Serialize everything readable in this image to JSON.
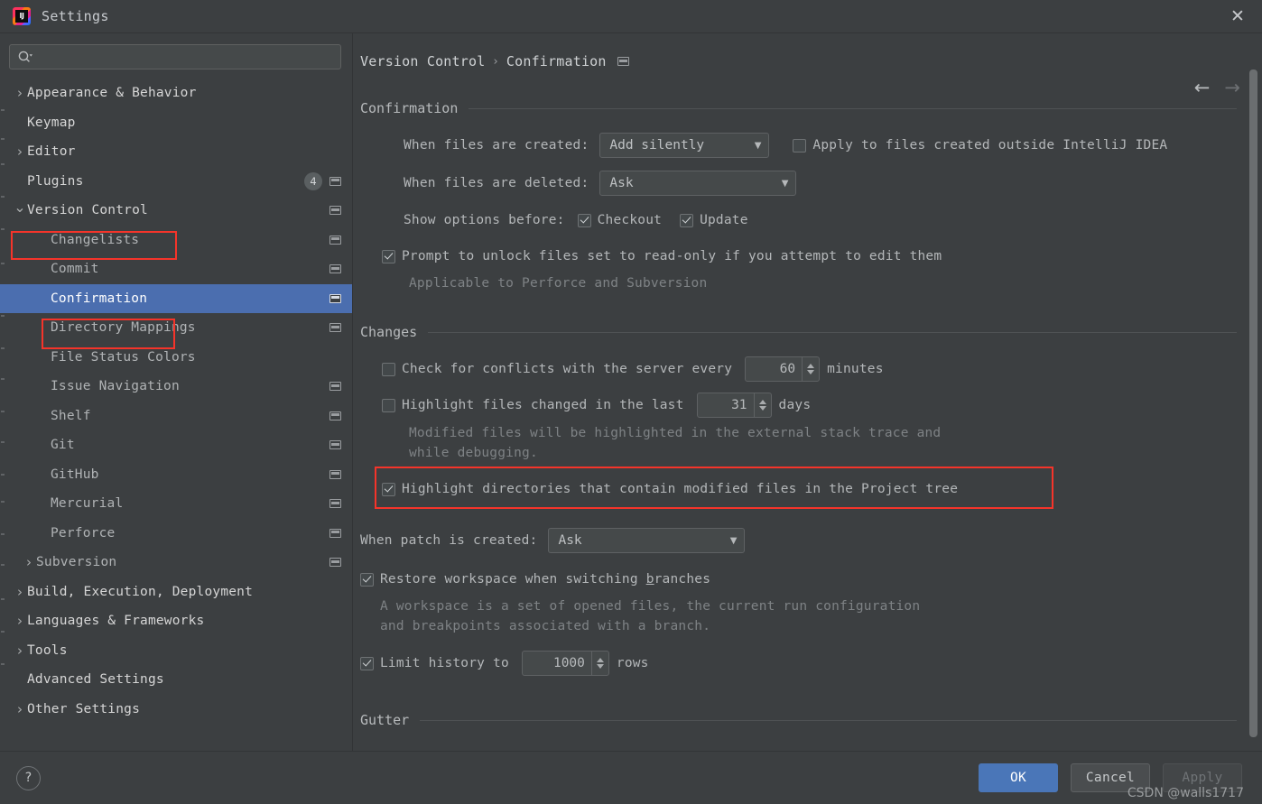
{
  "window": {
    "title": "Settings",
    "logo_icon": "intellij-idea-logo",
    "close_icon": "close-icon"
  },
  "search": {
    "value": "",
    "placeholder": "",
    "icon": "search-icon"
  },
  "sidebar": {
    "items": [
      {
        "label": "Appearance & Behavior",
        "level": 0,
        "arrow": "chevron-right",
        "badge": "",
        "trailing_icon": false,
        "selected": false
      },
      {
        "label": "Keymap",
        "level": 0,
        "arrow": "",
        "badge": "",
        "trailing_icon": false,
        "selected": false
      },
      {
        "label": "Editor",
        "level": 0,
        "arrow": "chevron-right",
        "badge": "",
        "trailing_icon": false,
        "selected": false
      },
      {
        "label": "Plugins",
        "level": 0,
        "arrow": "",
        "badge": "4",
        "trailing_icon": true,
        "selected": false
      },
      {
        "label": "Version Control",
        "level": 0,
        "arrow": "chevron-down",
        "badge": "",
        "trailing_icon": true,
        "selected": false
      },
      {
        "label": "Changelists",
        "level": 1,
        "arrow": "",
        "badge": "",
        "trailing_icon": true,
        "selected": false
      },
      {
        "label": "Commit",
        "level": 1,
        "arrow": "",
        "badge": "",
        "trailing_icon": true,
        "selected": false
      },
      {
        "label": "Confirmation",
        "level": 1,
        "arrow": "",
        "badge": "",
        "trailing_icon": true,
        "selected": true
      },
      {
        "label": "Directory Mappings",
        "level": 1,
        "arrow": "",
        "badge": "",
        "trailing_icon": true,
        "selected": false
      },
      {
        "label": "File Status Colors",
        "level": 1,
        "arrow": "",
        "badge": "",
        "trailing_icon": false,
        "selected": false
      },
      {
        "label": "Issue Navigation",
        "level": 1,
        "arrow": "",
        "badge": "",
        "trailing_icon": true,
        "selected": false
      },
      {
        "label": "Shelf",
        "level": 1,
        "arrow": "",
        "badge": "",
        "trailing_icon": true,
        "selected": false
      },
      {
        "label": "Git",
        "level": 1,
        "arrow": "",
        "badge": "",
        "trailing_icon": true,
        "selected": false
      },
      {
        "label": "GitHub",
        "level": 1,
        "arrow": "",
        "badge": "",
        "trailing_icon": true,
        "selected": false
      },
      {
        "label": "Mercurial",
        "level": 1,
        "arrow": "",
        "badge": "",
        "trailing_icon": true,
        "selected": false
      },
      {
        "label": "Perforce",
        "level": 1,
        "arrow": "",
        "badge": "",
        "trailing_icon": true,
        "selected": false
      },
      {
        "label": "Subversion",
        "level": 1,
        "arrow": "chevron-right",
        "badge": "",
        "trailing_icon": true,
        "selected": false
      },
      {
        "label": "Build, Execution, Deployment",
        "level": 0,
        "arrow": "chevron-right",
        "badge": "",
        "trailing_icon": false,
        "selected": false
      },
      {
        "label": "Languages & Frameworks",
        "level": 0,
        "arrow": "chevron-right",
        "badge": "",
        "trailing_icon": false,
        "selected": false
      },
      {
        "label": "Tools",
        "level": 0,
        "arrow": "chevron-right",
        "badge": "",
        "trailing_icon": false,
        "selected": false
      },
      {
        "label": "Advanced Settings",
        "level": 0,
        "arrow": "",
        "badge": "",
        "trailing_icon": false,
        "selected": false
      },
      {
        "label": "Other Settings",
        "level": 0,
        "arrow": "chevron-right",
        "badge": "",
        "trailing_icon": false,
        "selected": false
      }
    ]
  },
  "breadcrumb": {
    "root": "Version Control",
    "separator": "›",
    "leaf": "Confirmation",
    "icon": "window-icon"
  },
  "nav": {
    "back_icon": "arrow-left-icon",
    "forward_icon": "arrow-right-icon"
  },
  "main": {
    "groups": {
      "confirmation": "Confirmation",
      "changes": "Changes",
      "gutter": "Gutter"
    },
    "when_created": {
      "label": "When files are created:",
      "value": "Add silently"
    },
    "apply_outside": {
      "label": "Apply to files created outside IntelliJ IDEA",
      "checked": false
    },
    "when_deleted": {
      "label": "When files are deleted:",
      "value": "Ask"
    },
    "show_options": {
      "label": "Show options before:",
      "checkout": {
        "label": "Checkout",
        "checked": true
      },
      "update": {
        "label": "Update",
        "checked": true
      }
    },
    "prompt_unlock": {
      "label": "Prompt to unlock files set to read-only if you attempt to edit them",
      "checked": true,
      "hint": "Applicable to Perforce and Subversion"
    },
    "check_conflicts": {
      "label_before": "Check for conflicts with the server every",
      "value": "60",
      "label_after": "minutes",
      "checked": false
    },
    "highlight_changed": {
      "label_before": "Highlight files changed in the last",
      "value": "31",
      "label_after": "days",
      "checked": false,
      "hint_line1": "Modified files will be highlighted in the external stack trace and",
      "hint_line2": "while debugging."
    },
    "highlight_directories": {
      "label": "Highlight directories that contain modified files in the Project tree",
      "checked": true
    },
    "when_patch": {
      "label": "When patch is created:",
      "value": "Ask"
    },
    "restore_workspace": {
      "label_a": "Restore workspace when switching ",
      "mnemonic": "b",
      "label_b": "ranches",
      "checked": true,
      "hint_line1": "A workspace is a set of opened files, the current run configuration",
      "hint_line2": "and breakpoints associated with a branch."
    },
    "limit_history": {
      "label_before": "Limit history to",
      "value": "1000",
      "label_after": "rows",
      "checked": true
    }
  },
  "footer": {
    "help_label": "?",
    "ok_label": "OK",
    "cancel_label": "Cancel",
    "apply_label": "Apply"
  },
  "watermark": "CSDN @walls1717",
  "colors": {
    "background": "#3c3f41",
    "selection": "#4b6eaf",
    "primary_button": "#4a76b8",
    "annotation": "#f5342a"
  }
}
